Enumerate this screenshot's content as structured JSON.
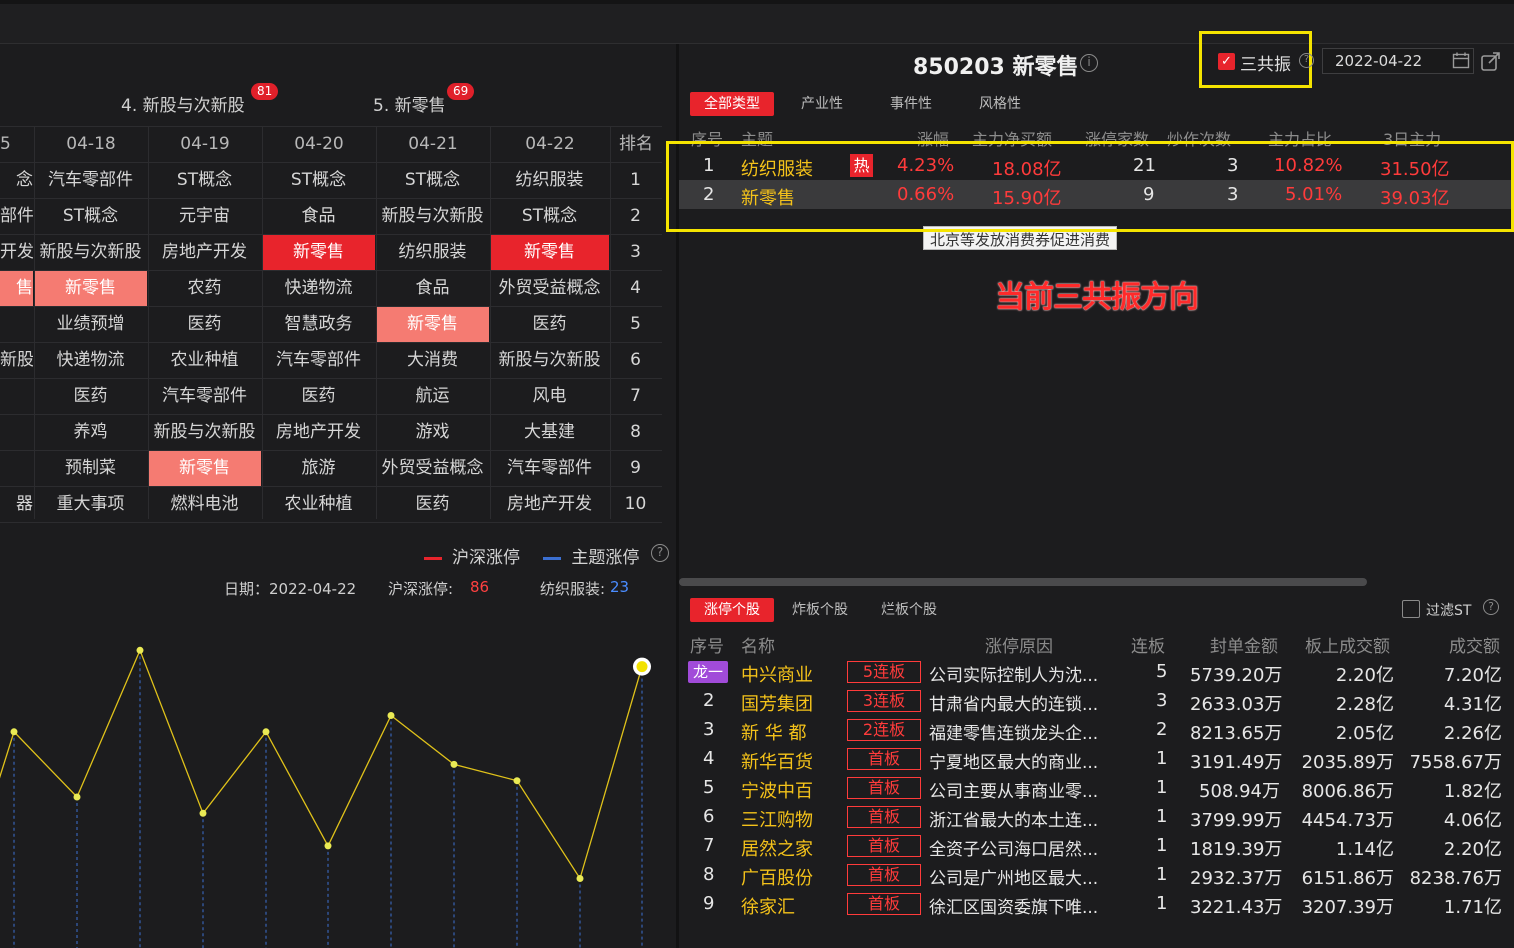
{
  "left": {
    "tabs": [
      {
        "label": "4. 新股与次新股",
        "badge": "81"
      },
      {
        "label": "5. 新零售",
        "badge": "69"
      }
    ],
    "grid": {
      "headers": [
        "5",
        "04-18",
        "04-19",
        "04-20",
        "04-21",
        "04-22",
        "排名"
      ],
      "rows": [
        [
          "念",
          "汽车零部件",
          "ST概念",
          "ST概念",
          "ST概念",
          "纺织服装",
          "1"
        ],
        [
          "部件",
          "ST概念",
          "元宇宙",
          "食品",
          "新股与次新股",
          "ST概念",
          "2"
        ],
        [
          "开发",
          "新股与次新股",
          "房地产开发",
          "新零售",
          "纺织服装",
          "新零售",
          "3"
        ],
        [
          "售",
          "新零售",
          "农药",
          "快递物流",
          "食品",
          "外贸受益概念",
          "4"
        ],
        [
          "",
          "业绩预增",
          "医药",
          "智慧政务",
          "新零售",
          "医药",
          "5"
        ],
        [
          "新股",
          "快递物流",
          "农业种植",
          "汽车零部件",
          "大消费",
          "新股与次新股",
          "6"
        ],
        [
          "",
          "医药",
          "汽车零部件",
          "医药",
          "航运",
          "风电",
          "7"
        ],
        [
          "",
          "养鸡",
          "新股与次新股",
          "房地产开发",
          "游戏",
          "大基建",
          "8"
        ],
        [
          "",
          "预制菜",
          "新零售",
          "旅游",
          "外贸受益概念",
          "汽车零部件",
          "9"
        ],
        [
          "器",
          "重大事项",
          "燃料电池",
          "农业种植",
          "医药",
          "房地产开发",
          "10"
        ]
      ]
    },
    "legend": {
      "series1": "沪深涨停",
      "series2": "主题涨停",
      "help": "?"
    },
    "chart_info": {
      "date_label": "日期：2022-04-22",
      "hs_label": "沪深涨停:",
      "hs_value": "86",
      "theme_label": "纺织服装:",
      "theme_value": "23"
    }
  },
  "chart_data": {
    "type": "line",
    "series": [
      {
        "name": "纺织服装",
        "values": [
          14,
          10,
          19,
          9,
          14,
          7,
          15,
          12,
          11,
          5,
          18
        ]
      }
    ],
    "colors": {
      "line": "#e0c21a",
      "point": "#eaea55",
      "dash": "#3b6fd1"
    }
  },
  "right": {
    "title": "850203 新零售",
    "resonance_label": "三共振",
    "date": "2022-04-22",
    "tabs": [
      "全部类型",
      "产业性",
      "事件性",
      "风格性"
    ],
    "headers": [
      "序号",
      "主题",
      "涨幅",
      "主力净买额",
      "涨停家数",
      "炒作次数",
      "主力占比",
      "3日主力"
    ],
    "rows": [
      {
        "no": "1",
        "theme": "纺织服装",
        "hot": "热",
        "pct": "4.23%",
        "net": "18.08亿",
        "limit": "21",
        "times": "3",
        "ratio": "10.82%",
        "three": "31.50亿"
      },
      {
        "no": "2",
        "theme": "新零售",
        "hot": "",
        "pct": "0.66%",
        "net": "15.90亿",
        "limit": "9",
        "times": "3",
        "ratio": "5.01%",
        "three": "39.03亿"
      }
    ],
    "tooltip": "北京等发放消费券促进消费",
    "annotation": "当前三共振方向",
    "bottom_tabs": [
      "涨停个股",
      "炸板个股",
      "烂板个股"
    ],
    "filter_label": "过滤ST",
    "bottom_headers": [
      "序号",
      "名称",
      "涨停原因",
      "连板",
      "封单金额",
      "板上成交额",
      "成交额"
    ],
    "stocks": [
      {
        "no": "龙一",
        "name": "中兴商业",
        "tag": "5连板",
        "reason": "公司实际控制人为沈...",
        "lb": "5",
        "seal": "5739.20万",
        "onboard": "2.20亿",
        "amount": "7.20亿"
      },
      {
        "no": "2",
        "name": "国芳集团",
        "tag": "3连板",
        "reason": "甘肃省内最大的连锁...",
        "lb": "3",
        "seal": "2633.03万",
        "onboard": "2.28亿",
        "amount": "4.31亿"
      },
      {
        "no": "3",
        "name": "新 华 都",
        "tag": "2连板",
        "reason": "福建零售连锁龙头企...",
        "lb": "2",
        "seal": "8213.65万",
        "onboard": "2.05亿",
        "amount": "2.26亿"
      },
      {
        "no": "4",
        "name": "新华百货",
        "tag": "首板",
        "reason": "宁夏地区最大的商业...",
        "lb": "1",
        "seal": "3191.49万",
        "onboard": "2035.89万",
        "amount": "7558.67万"
      },
      {
        "no": "5",
        "name": "宁波中百",
        "tag": "首板",
        "reason": "公司主要从事商业零...",
        "lb": "1",
        "seal": "508.94万",
        "onboard": "8006.86万",
        "amount": "1.82亿"
      },
      {
        "no": "6",
        "name": "三江购物",
        "tag": "首板",
        "reason": "浙江省最大的本土连...",
        "lb": "1",
        "seal": "3799.99万",
        "onboard": "4454.73万",
        "amount": "4.06亿"
      },
      {
        "no": "7",
        "name": "居然之家",
        "tag": "首板",
        "reason": "全资子公司海口居然...",
        "lb": "1",
        "seal": "1819.39万",
        "onboard": "1.14亿",
        "amount": "2.20亿"
      },
      {
        "no": "8",
        "name": "广百股份",
        "tag": "首板",
        "reason": "公司是广州地区最大...",
        "lb": "1",
        "seal": "2932.37万",
        "onboard": "6151.86万",
        "amount": "8238.76万"
      },
      {
        "no": "9",
        "name": "徐家汇",
        "tag": "首板",
        "reason": "徐汇区国资委旗下唯...",
        "lb": "1",
        "seal": "3221.43万",
        "onboard": "3207.39万",
        "amount": "1.71亿"
      }
    ]
  }
}
